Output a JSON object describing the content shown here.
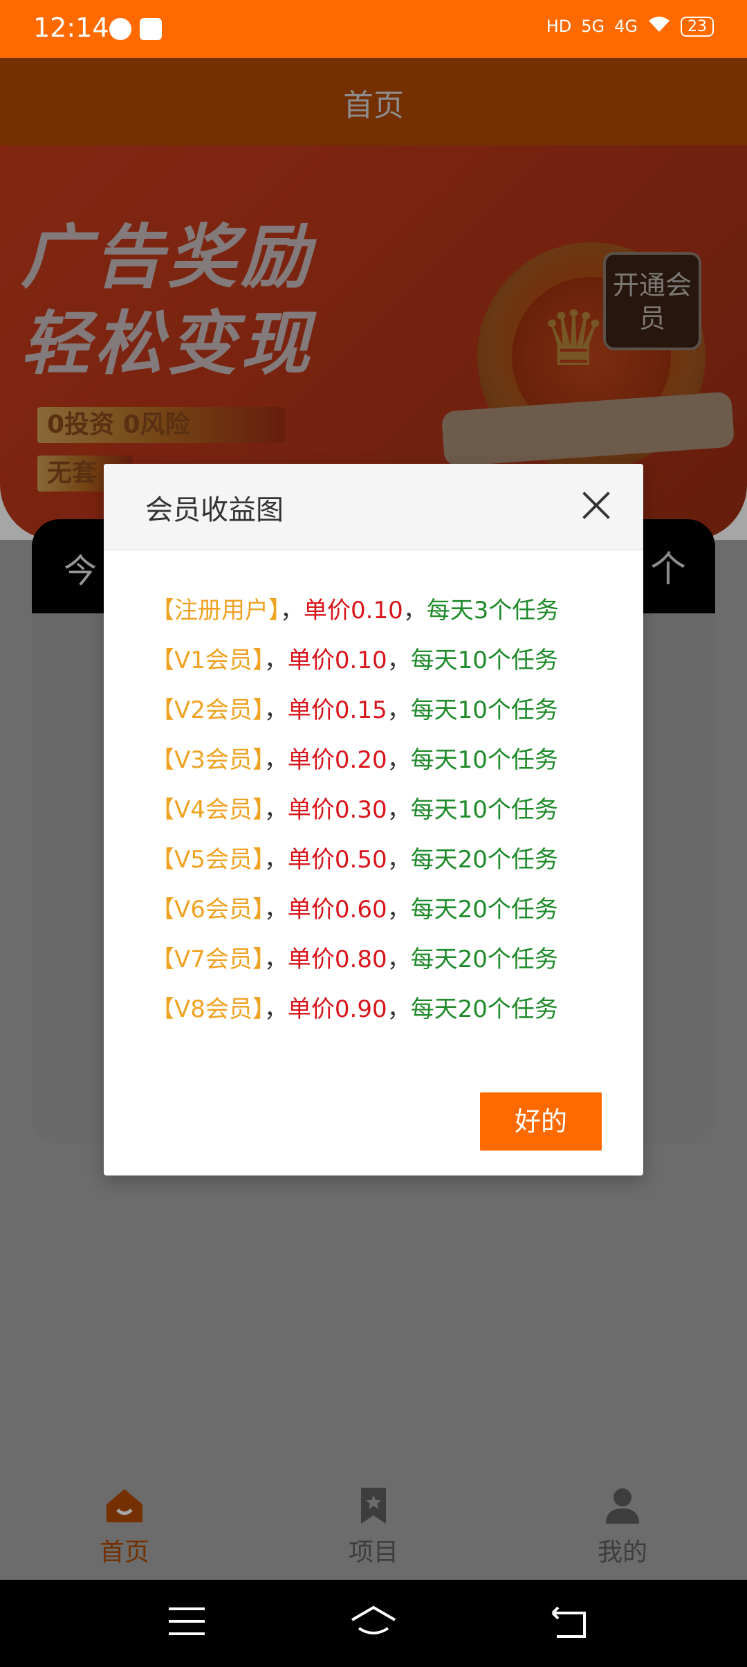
{
  "status_bar": {
    "time": "12:14",
    "battery": "23",
    "network_1": "HD",
    "network_2": "5G",
    "network_3": "4G"
  },
  "header": {
    "title": "首页"
  },
  "banner": {
    "headline_1": "广告奖励",
    "headline_2": "轻松变现",
    "tag_1": "0投资 0风险",
    "tag_2": "无套",
    "member_button": "开通会员"
  },
  "card": {
    "title_partial": "今",
    "right_icon": "个"
  },
  "modal": {
    "title": "会员收益图",
    "ok_label": "好的",
    "rows": [
      {
        "level": "【注册用户】",
        "sep1": "，",
        "price": "单价0.10",
        "sep2": "，",
        "tasks": "每天3个任务"
      },
      {
        "level": "【V1会员】",
        "sep1": "，",
        "price": "单价0.10",
        "sep2": "，",
        "tasks": "每天10个任务"
      },
      {
        "level": "【V2会员】",
        "sep1": "，",
        "price": "单价0.15",
        "sep2": "，",
        "tasks": "每天10个任务"
      },
      {
        "level": "【V3会员】",
        "sep1": "，",
        "price": "单价0.20",
        "sep2": "，",
        "tasks": "每天10个任务"
      },
      {
        "level": "【V4会员】",
        "sep1": "，",
        "price": "单价0.30",
        "sep2": "，",
        "tasks": "每天10个任务"
      },
      {
        "level": "【V5会员】",
        "sep1": "，",
        "price": "单价0.50",
        "sep2": "，",
        "tasks": "每天20个任务"
      },
      {
        "level": "【V6会员】",
        "sep1": "，",
        "price": "单价0.60",
        "sep2": "，",
        "tasks": "每天20个任务"
      },
      {
        "level": "【V7会员】",
        "sep1": "，",
        "price": "单价0.80",
        "sep2": "，",
        "tasks": "每天20个任务"
      },
      {
        "level": "【V8会员】",
        "sep1": "，",
        "price": "单价0.90",
        "sep2": "，",
        "tasks": "每天20个任务"
      }
    ]
  },
  "bottom_nav": {
    "items": [
      {
        "label": "首页",
        "icon": "home-icon",
        "active": true
      },
      {
        "label": "项目",
        "icon": "bookmark-star-icon",
        "active": false
      },
      {
        "label": "我的",
        "icon": "user-icon",
        "active": false
      }
    ]
  },
  "colors": {
    "accent": "#ff6a00",
    "header": "#b24a00",
    "level": "#f0a223",
    "price": "#d9141b",
    "tasks": "#1f8a2a"
  }
}
